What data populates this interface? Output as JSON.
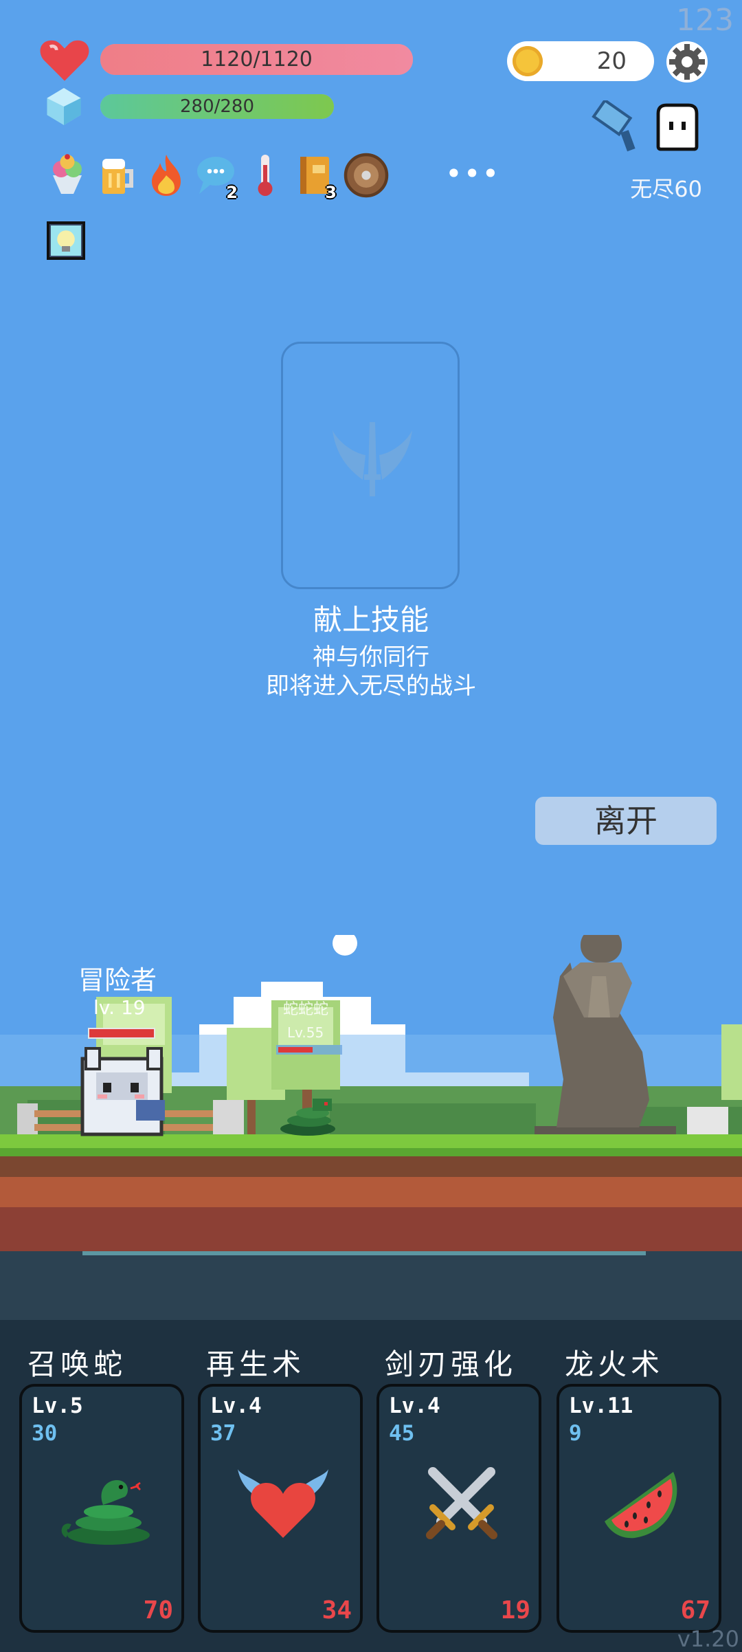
{
  "fps": "123",
  "hp": {
    "text": "1120/1120",
    "fraction": 1.0
  },
  "mp": {
    "text": "280/280",
    "fraction": 1.0
  },
  "gold": "20",
  "mode": "无尽60",
  "buffs": [
    {
      "icon": "ice-cream-icon",
      "badge": ""
    },
    {
      "icon": "beer-mug-icon",
      "badge": ""
    },
    {
      "icon": "fire-icon",
      "badge": ""
    },
    {
      "icon": "speech-bubble-icon",
      "badge": "2"
    },
    {
      "icon": "thermometer-icon",
      "badge": ""
    },
    {
      "icon": "book-icon",
      "badge": "3"
    },
    {
      "icon": "round-shield-icon",
      "badge": ""
    }
  ],
  "more": "•••",
  "shrine": {
    "title": "献上技能",
    "line1": "神与你同行",
    "line2": "即将进入无尽的战斗"
  },
  "leave_label": "离开",
  "player": {
    "name": "冒险者",
    "level": "lv. 19"
  },
  "enemy": {
    "name": "蛇蛇蛇",
    "level": "Lv.55"
  },
  "skills": [
    {
      "name": "召唤蛇",
      "level": "Lv.5",
      "cooldown": "30",
      "cost": "70",
      "icon": "snake-icon"
    },
    {
      "name": "再生术",
      "level": "Lv.4",
      "cooldown": "37",
      "cost": "34",
      "icon": "winged-heart-icon"
    },
    {
      "name": "剑刃强化",
      "level": "Lv.4",
      "cooldown": "45",
      "cost": "19",
      "icon": "crossed-swords-icon"
    },
    {
      "name": "龙火术",
      "level": "Lv.11",
      "cooldown": "9",
      "cost": "67",
      "icon": "watermelon-icon"
    }
  ],
  "version": "v1.20"
}
